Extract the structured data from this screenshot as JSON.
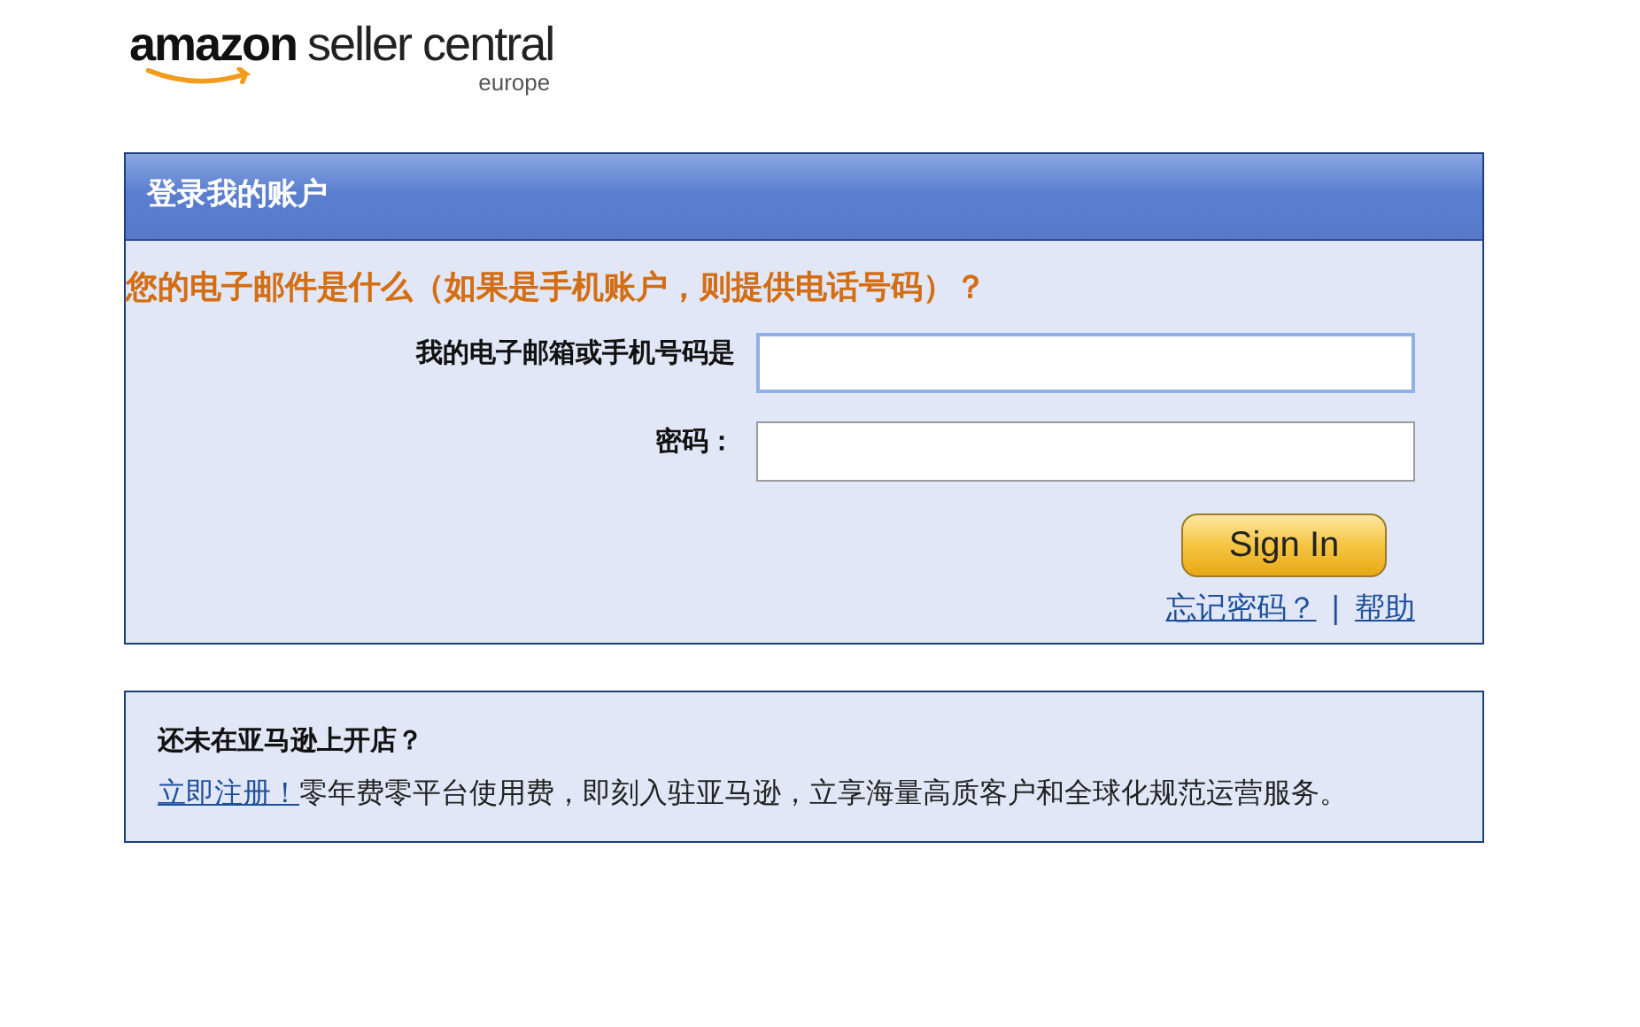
{
  "logo": {
    "brand": "amazon",
    "product": "seller central",
    "region": "europe"
  },
  "login_panel": {
    "title": "登录我的账户",
    "question": "您的电子邮件是什么（如果是手机账户，则提供电话号码）？",
    "fields": [
      {
        "label": "我的电子邮箱或手机号码是",
        "focused": true
      },
      {
        "label": "密码：",
        "focused": false
      }
    ],
    "button": "Sign In",
    "links": [
      "忘记密码？",
      "帮助"
    ],
    "separator": "|"
  },
  "signup_panel": {
    "title": "还未在亚马逊上开店？",
    "link": "立即注册！",
    "text": "零年费零平台使用费，即刻入驻亚马逊，立享海量高质客户和全球化规范运营服务。"
  }
}
